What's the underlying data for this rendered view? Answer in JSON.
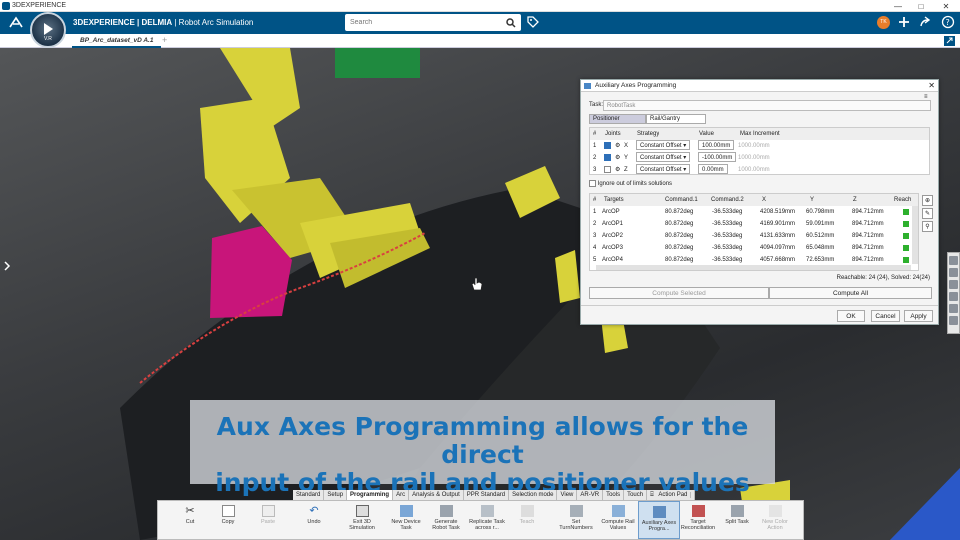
{
  "window": {
    "title": "3DEXPERIENCE",
    "minimize": "—",
    "maximize": "□",
    "close": "✕"
  },
  "topbar": {
    "brand_bold": "3DEXPERIENCE | DELMIA",
    "brand_rest": " | Robot Arc Simulation",
    "compass_version": "V.R",
    "search_placeholder": "Search",
    "user_initials": "TK"
  },
  "tabs": [
    {
      "label": "BP_Arc_dataset_vD A.1"
    }
  ],
  "dialog": {
    "title": "Auxiliary Axes Programming",
    "task_label": "Task:",
    "task_value": "RobotTask",
    "tabs": [
      "Positioner",
      "Rail/Gantry"
    ],
    "joints_headers": [
      "#",
      "Joints",
      "Strategy",
      "Value",
      "Max Increment"
    ],
    "joints": [
      {
        "n": "1",
        "axis": "X",
        "strategy": "Constant Offset",
        "value": "100.00mm",
        "max": "1000.00mm",
        "checked": true
      },
      {
        "n": "2",
        "axis": "Y",
        "strategy": "Constant Offset",
        "value": "-100.00mm",
        "max": "1000.00mm",
        "checked": true
      },
      {
        "n": "3",
        "axis": "Z",
        "strategy": "Constant Offset",
        "value": "0.00mm",
        "max": "1000.00mm",
        "checked": false
      }
    ],
    "ignore_label": "Ignore out of limits solutions",
    "targets_headers": [
      "#",
      "Targets",
      "Command.1",
      "Command.2",
      "X",
      "Y",
      "Z",
      "Reach"
    ],
    "targets": [
      {
        "n": "1",
        "name": "ArcOP",
        "c1": "80.872deg",
        "c2": "-36.533deg",
        "x": "4208.519mm",
        "y": "60.798mm",
        "z": "894.712mm"
      },
      {
        "n": "2",
        "name": "ArcOP1",
        "c1": "80.872deg",
        "c2": "-36.533deg",
        "x": "4169.901mm",
        "y": "59.091mm",
        "z": "894.712mm"
      },
      {
        "n": "3",
        "name": "ArcOP2",
        "c1": "80.872deg",
        "c2": "-36.533deg",
        "x": "4131.633mm",
        "y": "60.512mm",
        "z": "894.712mm"
      },
      {
        "n": "4",
        "name": "ArcOP3",
        "c1": "80.872deg",
        "c2": "-36.533deg",
        "x": "4094.097mm",
        "y": "65.048mm",
        "z": "894.712mm"
      },
      {
        "n": "5",
        "name": "ArcOP4",
        "c1": "80.872deg",
        "c2": "-36.533deg",
        "x": "4057.668mm",
        "y": "72.653mm",
        "z": "894.712mm"
      }
    ],
    "reach_summary": "Reachable: 24 (24), Solved: 24(24)",
    "compute_selected": "Compute Selected",
    "compute_all": "Compute All",
    "ok": "OK",
    "cancel": "Cancel",
    "apply": "Apply"
  },
  "caption": {
    "line1": "Aux Axes Programming allows for the direct",
    "line2": "input of the rail and positioner values"
  },
  "ribbon_tabs": [
    "Standard",
    "Setup",
    "Programming",
    "Arc",
    "Analysis & Output",
    "PPR Standard",
    "Selection mode",
    "View",
    "AR-VR",
    "Tools",
    "Touch",
    "Action Pad"
  ],
  "ribbon_active": "Programming",
  "ribbon": [
    {
      "label": "Cut"
    },
    {
      "label": "Copy"
    },
    {
      "label": "Paste"
    },
    {
      "label": "Undo"
    },
    {
      "label": "Exit 3D Simulation"
    },
    {
      "label": "New Device Task"
    },
    {
      "label": "Generate Robot Task"
    },
    {
      "label": "Replicate Task across r..."
    },
    {
      "label": "Teach"
    },
    {
      "label": "Set TurnNumbers"
    },
    {
      "label": "Compute Rail Values"
    },
    {
      "label": "Auxiliary Axes Progra..."
    },
    {
      "label": "Target Reconciliation"
    },
    {
      "label": "Split Task"
    },
    {
      "label": "New Color Action"
    }
  ],
  "colors": {
    "topbar": "#005386",
    "accent": "#1b73b8",
    "robot": "#d8d23a",
    "part": "#c8157a"
  }
}
